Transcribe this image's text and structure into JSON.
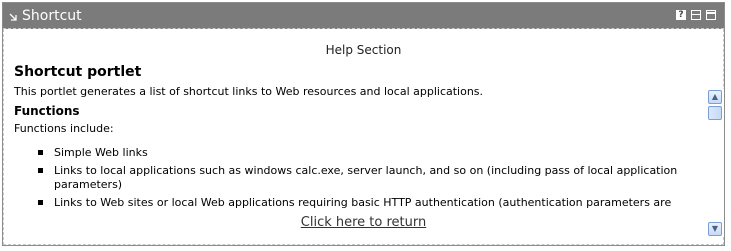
{
  "portlet": {
    "title": "Shortcut",
    "title_icons": [
      "collapse-arrow-icon",
      "help-icon",
      "restore-icon",
      "maximize-icon"
    ],
    "help_icon_glyph": "?"
  },
  "help": {
    "section_header": "Help Section",
    "heading": "Shortcut portlet",
    "intro": "This portlet generates a list of shortcut links to Web resources and local applications.",
    "functions_heading": "Functions",
    "functions_intro": "Functions include:",
    "items": [
      "Simple Web links",
      "Links to local applications such as windows calc.exe, server launch, and so on (including pass of local application parameters)",
      "Links to Web sites or local Web applications requiring basic HTTP authentication (authentication parameters are"
    ],
    "return_link": "Click here to return"
  },
  "scrollbar": {
    "up_glyph": "▲",
    "down_glyph": "▼"
  },
  "colors": {
    "titlebar": "#7b7b7b",
    "scrollbar_accent": "#7a9fd4"
  }
}
